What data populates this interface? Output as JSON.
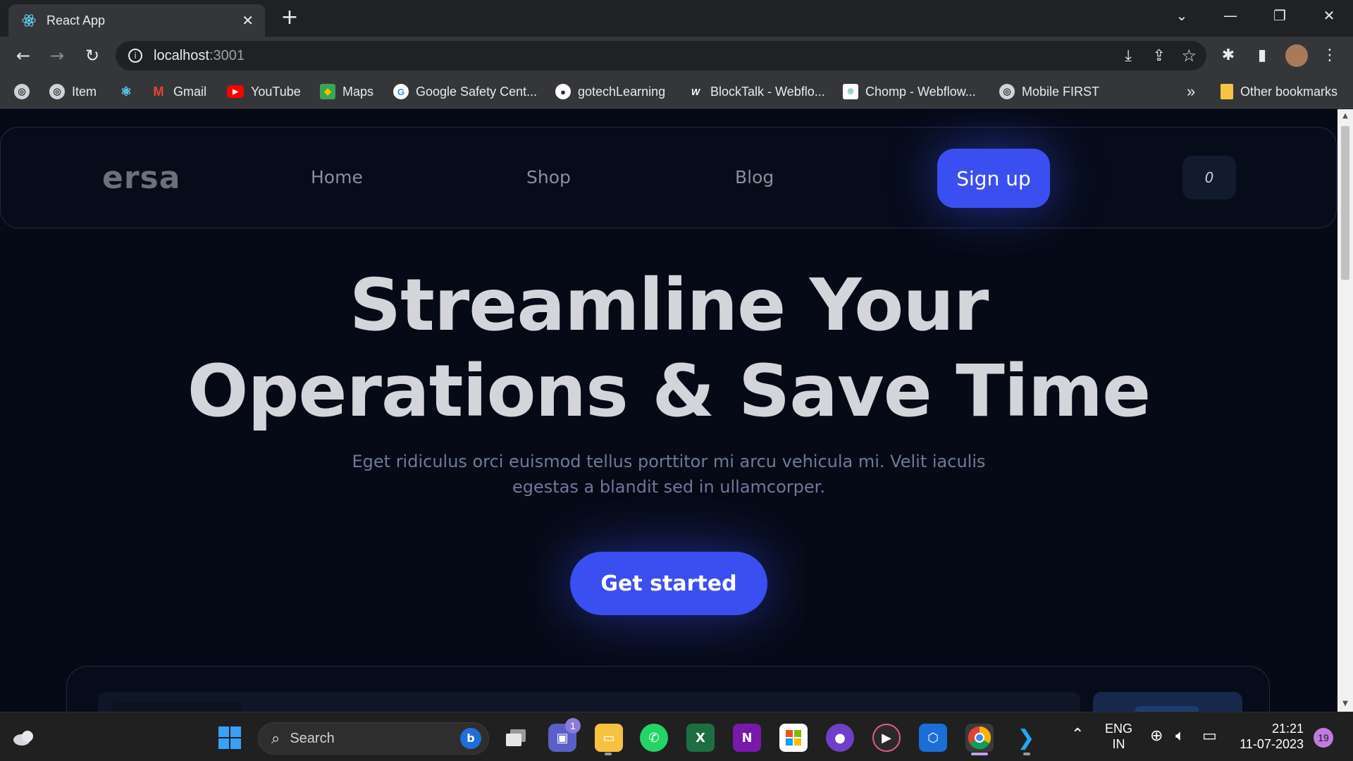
{
  "browser": {
    "tab_title": "React App",
    "tab_close": "✕",
    "new_tab": "+",
    "url_host": "localhost",
    "url_port": ":3001",
    "bookmarks": [
      {
        "label": "",
        "icon": "globe-icon"
      },
      {
        "label": "Item",
        "icon": "globe-icon"
      },
      {
        "label": "",
        "icon": "react-icon"
      },
      {
        "label": "Gmail",
        "icon": "gmail-icon"
      },
      {
        "label": "YouTube",
        "icon": "youtube-icon"
      },
      {
        "label": "Maps",
        "icon": "maps-icon"
      },
      {
        "label": "Google Safety Cent...",
        "icon": "google-icon"
      },
      {
        "label": "gotechLearning",
        "icon": "github-icon"
      },
      {
        "label": "BlockTalk - Webflo...",
        "icon": "webflow-icon"
      },
      {
        "label": "Chomp - Webflow...",
        "icon": "chomp-icon"
      },
      {
        "label": "Mobile FIRST",
        "icon": "globe-icon"
      }
    ],
    "overflow": "»",
    "other_bookmarks": "Other bookmarks"
  },
  "site": {
    "brand": "ersa",
    "nav": [
      "Home",
      "Shop",
      "Blog"
    ],
    "signup_label": "Sign up",
    "cart_count": "0",
    "hero_line1": "Streamline Your",
    "hero_line2": "Operations & Save Time",
    "hero_subtitle": "Eget ridiculus orci euismod tellus porttitor mi arcu vehicula mi. Velit iaculis egestas a blandit sed in ullamcorper.",
    "cta_label": "Get started",
    "accent_color": "#3b4ff0"
  },
  "taskbar": {
    "search_label": "Search",
    "chat_badge": "1",
    "lang_line1": "ENG",
    "lang_line2": "IN",
    "time": "21:21",
    "date": "11-07-2023",
    "notification_count": "19"
  }
}
